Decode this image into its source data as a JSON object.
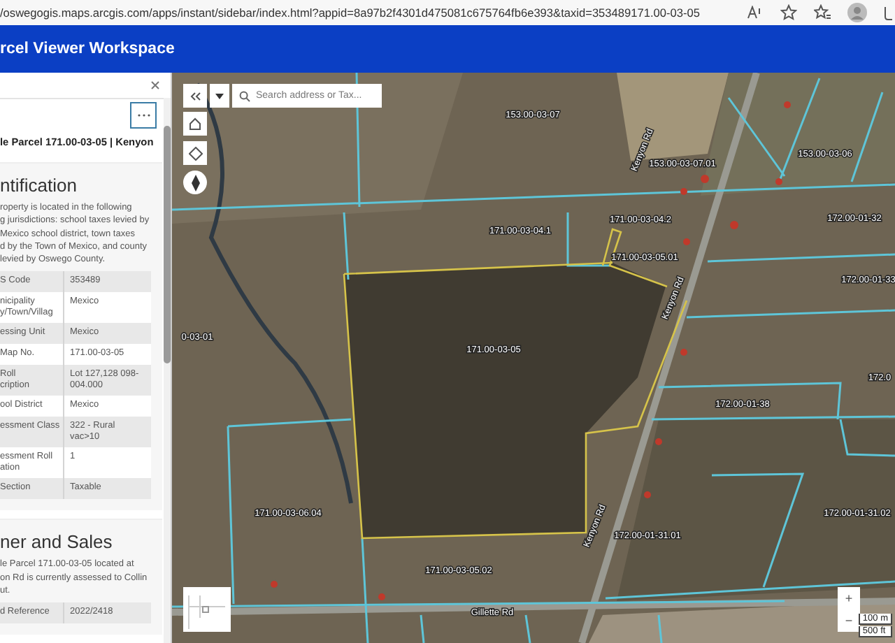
{
  "browser": {
    "url": "/oswegogis.maps.arcgis.com/apps/instant/sidebar/index.html?appid=8a97b2f4301d475081c675764fb6e393&taxid=353489171.00-03-05"
  },
  "app_header": {
    "title": "rcel Viewer Workspace"
  },
  "panel": {
    "title": "le Parcel 171.00-03-05 | Kenyon",
    "sections": [
      {
        "heading": "ntification",
        "description": [
          "roperty is located in the following",
          "g jurisdictions: school taxes levied by",
          "Mexico school district, town taxes",
          "d by the Town of Mexico, and county",
          "levied by Oswego County."
        ],
        "rows": [
          {
            "label": "S Code",
            "value": "353489"
          },
          {
            "label": "nicipality\ny/Town/Villag",
            "value": "Mexico"
          },
          {
            "label": "essing Unit",
            "value": "Mexico"
          },
          {
            "label": "Map No.",
            "value": "171.00-03-05"
          },
          {
            "label": "Roll\ncription",
            "value": "Lot 127,128 098-\n004.000"
          },
          {
            "label": "ool District",
            "value": "Mexico"
          },
          {
            "label": "essment Class",
            "value": "322 - Rural\nvac>10"
          },
          {
            "label": "essment Roll\nation",
            "value": "1"
          },
          {
            "label": "Section",
            "value": "Taxable"
          }
        ]
      },
      {
        "heading": "ner and Sales",
        "description": [
          "le Parcel 171.00-03-05 located at",
          "on Rd is currently assessed to Collin",
          "ut."
        ],
        "rows": [
          {
            "label": "d Reference",
            "value": "2022/2418"
          }
        ]
      }
    ]
  },
  "map": {
    "search": {
      "placeholder": "Search address or Tax..."
    },
    "parcel_labels": [
      "153.00-03-07",
      "153.00-03-07.01",
      "153.00-03-06",
      "171.00-03-04.1",
      "171.00-03-04.2",
      "171.00-03-05.01",
      "172.00-01-32",
      "172.00-01-33",
      "0-03-01",
      "171.00-03-05",
      "172.00-01-38",
      "172.0",
      "171.00-03-06.04",
      "172.00-01-31.01",
      "172.00-01-31.02",
      "171.00-03-05.02"
    ],
    "road_labels": [
      {
        "text": "Kenyon Rd",
        "kind": "vertical"
      },
      {
        "text": "Kenyon Rd",
        "kind": "vertical"
      },
      {
        "text": "Kenyon Rd",
        "kind": "vertical"
      },
      {
        "text": "Gillette Rd",
        "kind": "horizontal"
      }
    ],
    "zoom_in": "+",
    "zoom_out": "−",
    "scale": [
      "100 m",
      "500 ft"
    ]
  }
}
